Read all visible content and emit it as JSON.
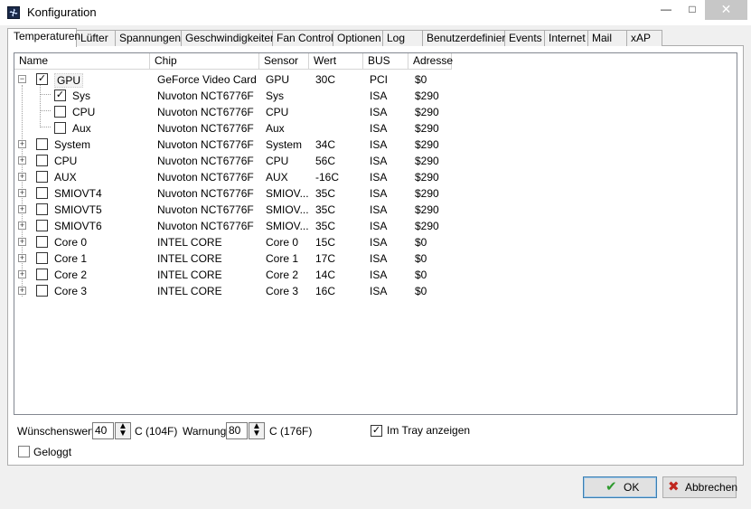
{
  "window": {
    "title": "Konfiguration",
    "minimize_glyph": "—",
    "maximize_glyph": "□",
    "close_glyph": "✕"
  },
  "tabs": [
    {
      "label": "Temperaturen",
      "active": true
    },
    {
      "label": "Lüfter"
    },
    {
      "label": "Spannungen"
    },
    {
      "label": "Geschwindigkeiten"
    },
    {
      "label": "Fan Control"
    },
    {
      "label": "Optionen"
    },
    {
      "label": "Log"
    },
    {
      "label": "Benutzerdefiniert"
    },
    {
      "label": "Events"
    },
    {
      "label": "Internet"
    },
    {
      "label": "Mail"
    },
    {
      "label": "xAP"
    }
  ],
  "columns": [
    "Name",
    "Chip",
    "Sensor",
    "Wert",
    "BUS",
    "Adresse"
  ],
  "rows": [
    {
      "name": "GPU",
      "chip": "GeForce Video Card",
      "sensor": "GPU",
      "wert": "30C",
      "bus": "PCI",
      "adresse": "$0",
      "checked": true,
      "expander": "−",
      "level": 0
    },
    {
      "name": "Sys",
      "chip": "Nuvoton NCT6776F",
      "sensor": "Sys",
      "wert": "",
      "bus": "ISA",
      "adresse": "$290",
      "checked": true,
      "level": 1
    },
    {
      "name": "CPU",
      "chip": "Nuvoton NCT6776F",
      "sensor": "CPU",
      "wert": "",
      "bus": "ISA",
      "adresse": "$290",
      "checked": false,
      "level": 1
    },
    {
      "name": "Aux",
      "chip": "Nuvoton NCT6776F",
      "sensor": "Aux",
      "wert": "",
      "bus": "ISA",
      "adresse": "$290",
      "checked": false,
      "level": 1
    },
    {
      "name": "System",
      "chip": "Nuvoton NCT6776F",
      "sensor": "System",
      "wert": "34C",
      "bus": "ISA",
      "adresse": "$290",
      "checked": false,
      "expander": "+",
      "level": 0
    },
    {
      "name": "CPU",
      "chip": "Nuvoton NCT6776F",
      "sensor": "CPU",
      "wert": "56C",
      "bus": "ISA",
      "adresse": "$290",
      "checked": false,
      "expander": "+",
      "level": 0
    },
    {
      "name": "AUX",
      "chip": "Nuvoton NCT6776F",
      "sensor": "AUX",
      "wert": "-16C",
      "bus": "ISA",
      "adresse": "$290",
      "checked": false,
      "expander": "+",
      "level": 0
    },
    {
      "name": "SMIOVT4",
      "chip": "Nuvoton NCT6776F",
      "sensor": "SMIOV...",
      "wert": "35C",
      "bus": "ISA",
      "adresse": "$290",
      "checked": false,
      "expander": "+",
      "level": 0
    },
    {
      "name": "SMIOVT5",
      "chip": "Nuvoton NCT6776F",
      "sensor": "SMIOV...",
      "wert": "35C",
      "bus": "ISA",
      "adresse": "$290",
      "checked": false,
      "expander": "+",
      "level": 0
    },
    {
      "name": "SMIOVT6",
      "chip": "Nuvoton NCT6776F",
      "sensor": "SMIOV...",
      "wert": "35C",
      "bus": "ISA",
      "adresse": "$290",
      "checked": false,
      "expander": "+",
      "level": 0
    },
    {
      "name": "Core 0",
      "chip": "INTEL CORE",
      "sensor": "Core 0",
      "wert": "15C",
      "bus": "ISA",
      "adresse": "$0",
      "checked": false,
      "expander": "+",
      "level": 0
    },
    {
      "name": "Core 1",
      "chip": "INTEL CORE",
      "sensor": "Core 1",
      "wert": "17C",
      "bus": "ISA",
      "adresse": "$0",
      "checked": false,
      "expander": "+",
      "level": 0
    },
    {
      "name": "Core 2",
      "chip": "INTEL CORE",
      "sensor": "Core 2",
      "wert": "14C",
      "bus": "ISA",
      "adresse": "$0",
      "checked": false,
      "expander": "+",
      "level": 0
    },
    {
      "name": "Core 3",
      "chip": "INTEL CORE",
      "sensor": "Core 3",
      "wert": "16C",
      "bus": "ISA",
      "adresse": "$0",
      "checked": false,
      "expander": "+",
      "level": 0
    }
  ],
  "settings": {
    "wunschwert_label": "Wünschenswert",
    "wunschwert_value": "40",
    "wunschwert_unit": "C (104F)",
    "warnung_label": "Warnung",
    "warnung_value": "80",
    "warnung_unit": "C (176F)",
    "tray_label": "Im Tray anzeigen",
    "tray_checked": true,
    "geloggt_label": "Geloggt",
    "geloggt_checked": false,
    "spin_up": "▲",
    "spin_down": "▼"
  },
  "buttons": {
    "ok_label": "OK",
    "cancel_label": "Abbrechen",
    "ok_icon": "✔",
    "cancel_icon": "✖"
  },
  "colors": {
    "ok_icon": "#2e9a2e",
    "cancel_icon": "#c0271f",
    "close_button": "#c7c7c7"
  }
}
